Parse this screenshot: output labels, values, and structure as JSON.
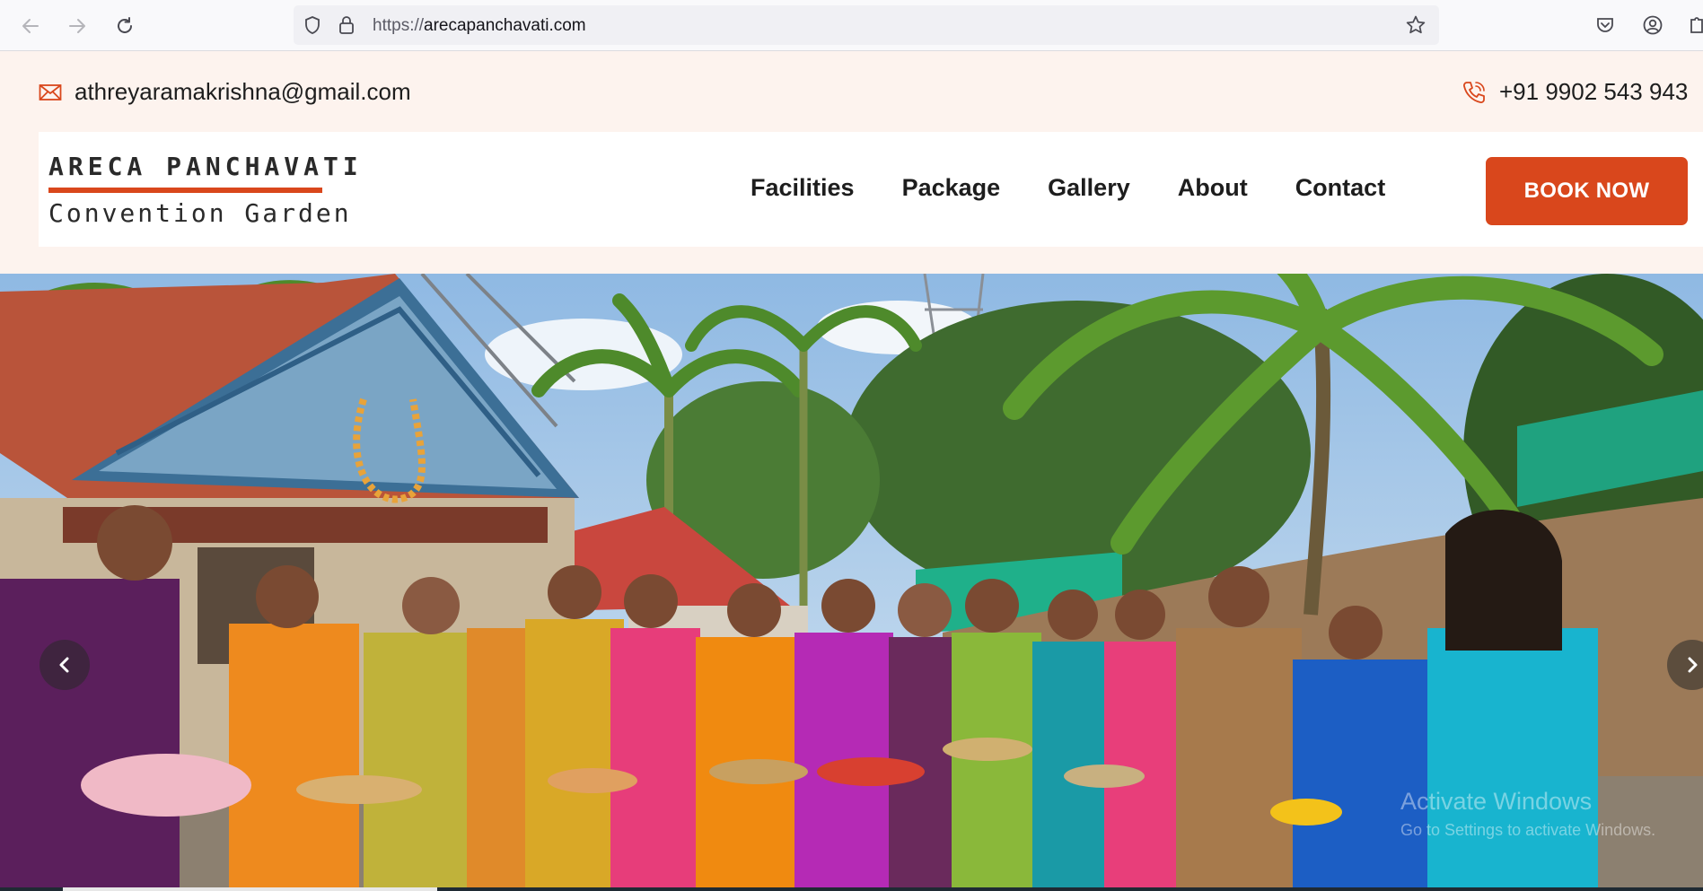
{
  "browser": {
    "url_scheme": "https://",
    "url_host": "arecapanchavati.com"
  },
  "contact": {
    "email": "athreyaramakrishna@gmail.com",
    "phone": "+91 9902 543 943"
  },
  "brand": {
    "name_top": "ARECA PANCHAVATI",
    "name_bottom": "Convention Garden",
    "accent_color": "#d9471c"
  },
  "nav": {
    "items": [
      {
        "label": "Facilities"
      },
      {
        "label": "Package"
      },
      {
        "label": "Gallery"
      },
      {
        "label": "About"
      },
      {
        "label": "Contact"
      }
    ],
    "cta_label": "BOOK NOW"
  },
  "hero": {
    "image_alt": "Group of women in colourful sarees holding festive plates in front of the convention garden hall",
    "watermark_line1": "Activate Windows",
    "watermark_line2": "Go to Settings to activate Windows."
  },
  "icons": {
    "back": "arrow-left-icon",
    "forward": "arrow-right-icon",
    "reload": "reload-icon",
    "tracking": "shield-icon",
    "lock": "lock-icon",
    "bookmark": "star-icon",
    "pocket": "pocket-icon",
    "account": "account-icon",
    "email": "envelope-icon",
    "phone": "phone-icon",
    "carousel_prev": "chevron-left-icon",
    "carousel_next": "chevron-right-icon"
  }
}
